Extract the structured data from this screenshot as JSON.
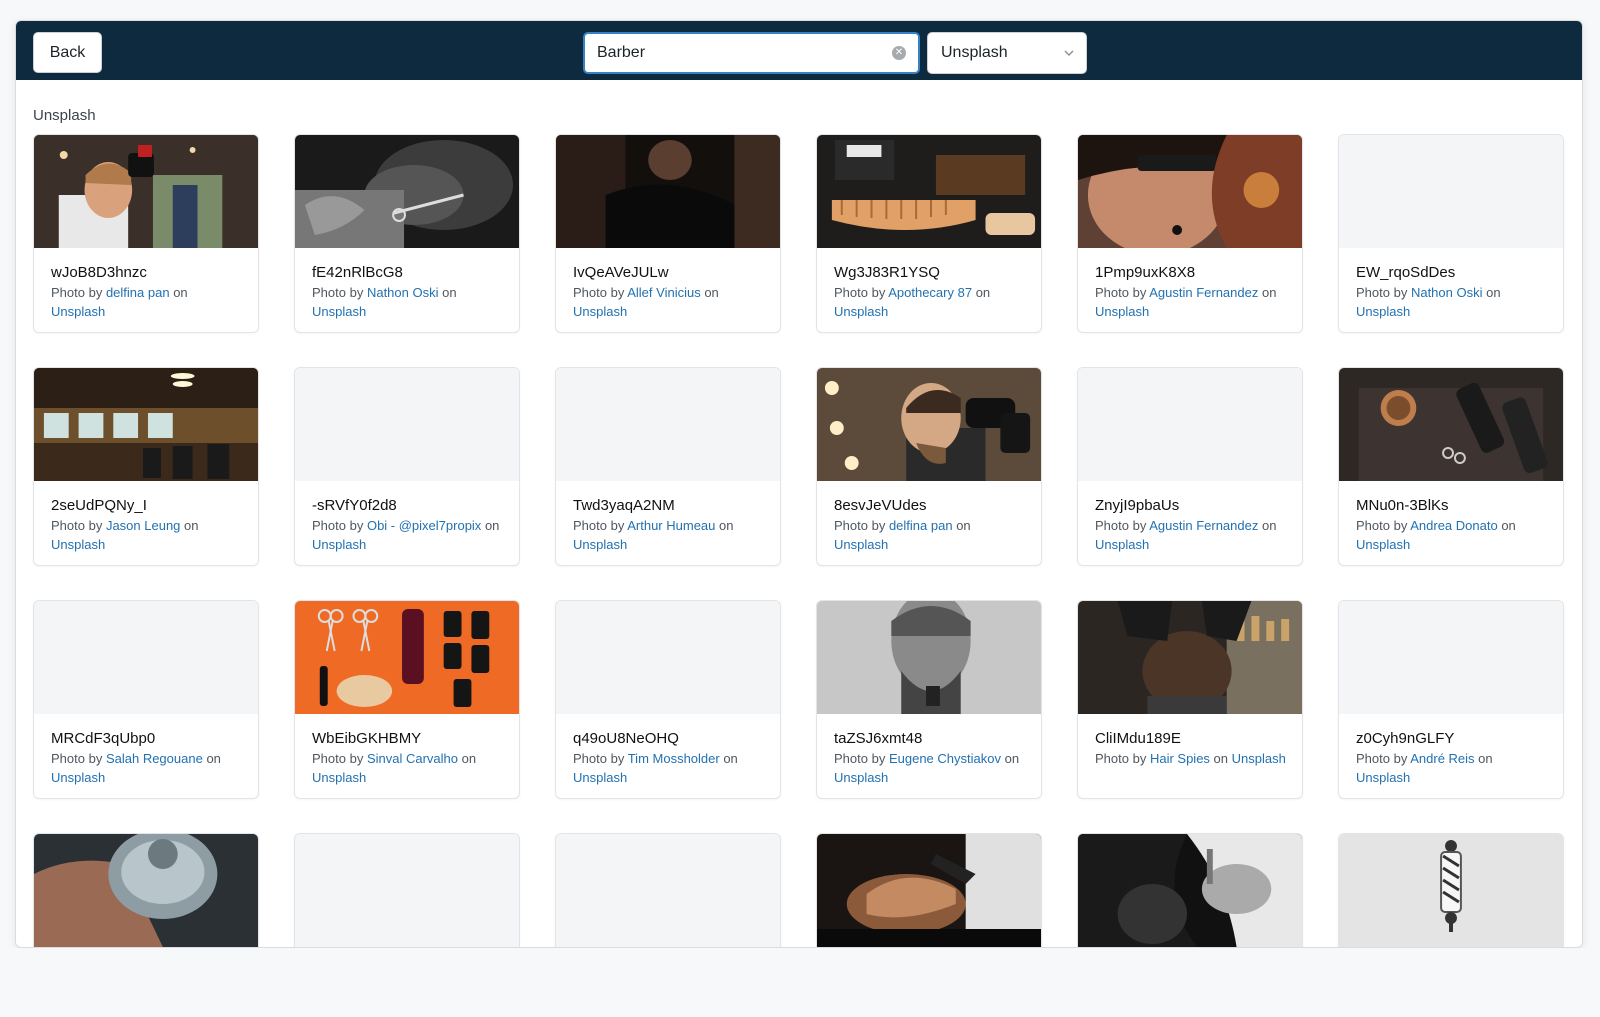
{
  "toolbar": {
    "back_label": "Back",
    "search_value": "Barber",
    "source_selected": "Unsplash"
  },
  "section_title": "Unsplash",
  "photos": [
    {
      "id": "wJoB8D3hnzc",
      "prefix": "Photo by",
      "author": "delfina pan",
      "on": "on",
      "source": "Unsplash",
      "thumb": "barber-cutting-hair"
    },
    {
      "id": "fE42nRlBcG8",
      "prefix": "Photo by",
      "author": "Nathon Oski",
      "on": "on",
      "source": "Unsplash",
      "thumb": "beard-trim-bw"
    },
    {
      "id": "IvQeAVeJULw",
      "prefix": "Photo by",
      "author": "Allef Vinicius",
      "on": "on",
      "source": "Unsplash",
      "thumb": "dark-shave"
    },
    {
      "id": "Wg3J83R1YSQ",
      "prefix": "Photo by",
      "author": "Apothecary 87",
      "on": "on",
      "source": "Unsplash",
      "thumb": "comb-products"
    },
    {
      "id": "1Pmp9uxK8X8",
      "prefix": "Photo by",
      "author": "Agustin Fernandez",
      "on": "on",
      "source": "Unsplash",
      "thumb": "fade-clipper"
    },
    {
      "id": "EW_rqoSdDes",
      "prefix": "Photo by",
      "author": "Nathon Oski",
      "on": "on",
      "source": "Unsplash",
      "thumb": "empty"
    },
    {
      "id": "2seUdPQNy_I",
      "prefix": "Photo by",
      "author": "Jason Leung",
      "on": "on",
      "source": "Unsplash",
      "thumb": "barbershop-interior"
    },
    {
      "id": "-sRVfY0f2d8",
      "prefix": "Photo by",
      "author": "Obi - @pixel7propix",
      "on": "on",
      "source": "Unsplash",
      "thumb": "empty"
    },
    {
      "id": "Twd3yaqA2NM",
      "prefix": "Photo by",
      "author": "Arthur Humeau",
      "on": "on",
      "source": "Unsplash",
      "thumb": "empty"
    },
    {
      "id": "8esvJeVUdes",
      "prefix": "Photo by",
      "author": "delfina pan",
      "on": "on",
      "source": "Unsplash",
      "thumb": "hairdryer"
    },
    {
      "id": "ZnyjI9pbaUs",
      "prefix": "Photo by",
      "author": "Agustin Fernandez",
      "on": "on",
      "source": "Unsplash",
      "thumb": "empty"
    },
    {
      "id": "MNu0n-3BlKs",
      "prefix": "Photo by",
      "author": "Andrea Donato",
      "on": "on",
      "source": "Unsplash",
      "thumb": "tools-flatlay"
    },
    {
      "id": "MRCdF3qUbp0",
      "prefix": "Photo by",
      "author": "Salah Regouane",
      "on": "on",
      "source": "Unsplash",
      "thumb": "empty"
    },
    {
      "id": "WbEibGKHBMY",
      "prefix": "Photo by",
      "author": "Sinval Carvalho",
      "on": "on",
      "source": "Unsplash",
      "thumb": "orange-tools"
    },
    {
      "id": "q49oU8NeOHQ",
      "prefix": "Photo by",
      "author": "Tim Mossholder",
      "on": "on",
      "source": "Unsplash",
      "thumb": "empty"
    },
    {
      "id": "taZSJ6xmt48",
      "prefix": "Photo by",
      "author": "Eugene Chystiakov",
      "on": "on",
      "source": "Unsplash",
      "thumb": "portrait-bw"
    },
    {
      "id": "CliIMdu189E",
      "prefix": "Photo by",
      "author": "Hair Spies",
      "on": "on",
      "source": "Unsplash",
      "thumb": "haircut-back"
    },
    {
      "id": "z0Cyh9nGLFY",
      "prefix": "Photo by",
      "author": "André Reis",
      "on": "on",
      "source": "Unsplash",
      "thumb": "empty"
    },
    {
      "id": "",
      "prefix": "",
      "author": "",
      "on": "",
      "source": "",
      "thumb": "tin-hand"
    },
    {
      "id": "",
      "prefix": "",
      "author": "",
      "on": "",
      "source": "",
      "thumb": "empty"
    },
    {
      "id": "",
      "prefix": "",
      "author": "",
      "on": "",
      "source": "",
      "thumb": "empty"
    },
    {
      "id": "",
      "prefix": "",
      "author": "",
      "on": "",
      "source": "",
      "thumb": "shave-chair"
    },
    {
      "id": "",
      "prefix": "",
      "author": "",
      "on": "",
      "source": "",
      "thumb": "bw-hands"
    },
    {
      "id": "",
      "prefix": "",
      "author": "",
      "on": "",
      "source": "",
      "thumb": "barber-pole"
    }
  ]
}
